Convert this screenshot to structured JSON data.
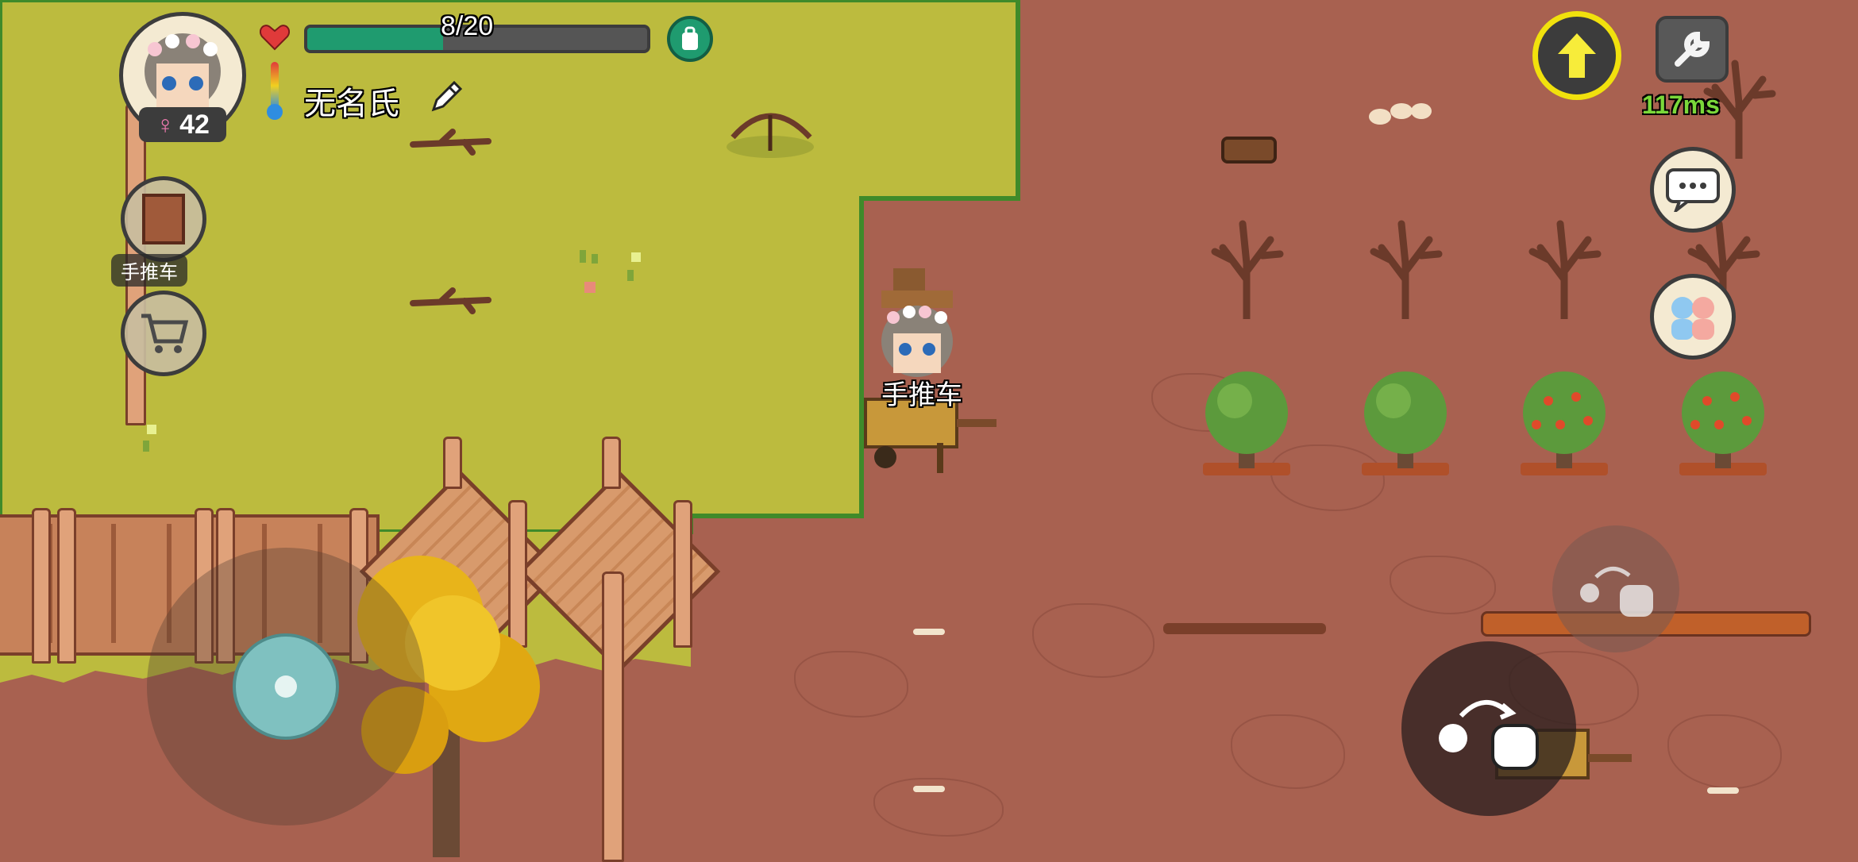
{
  "player": {
    "name": "无名氏",
    "age": "42",
    "gender_symbol": "♀",
    "health_text": "8/20",
    "health_fraction": 0.4,
    "overhead_label": "手推车"
  },
  "hud": {
    "held_item_label": "手推车",
    "ping_text": "117ms"
  },
  "colors": {
    "grass": "#bcbb3e",
    "dirt": "#a86150",
    "health_fill": "#1f9b6f",
    "ping_text": "#7ad83a",
    "upgrade_ring": "#f1e10d"
  },
  "icons": {
    "heart": "heart-icon",
    "thermometer": "thermometer-icon",
    "edit": "pencil-icon",
    "backpack": "backpack-icon",
    "upgrade": "arrow-up-icon",
    "settings": "wrench-icon",
    "chat": "speech-bubble-icon",
    "friends": "friends-icon",
    "cart": "shopping-cart-icon",
    "throw": "throw-hand-icon"
  }
}
